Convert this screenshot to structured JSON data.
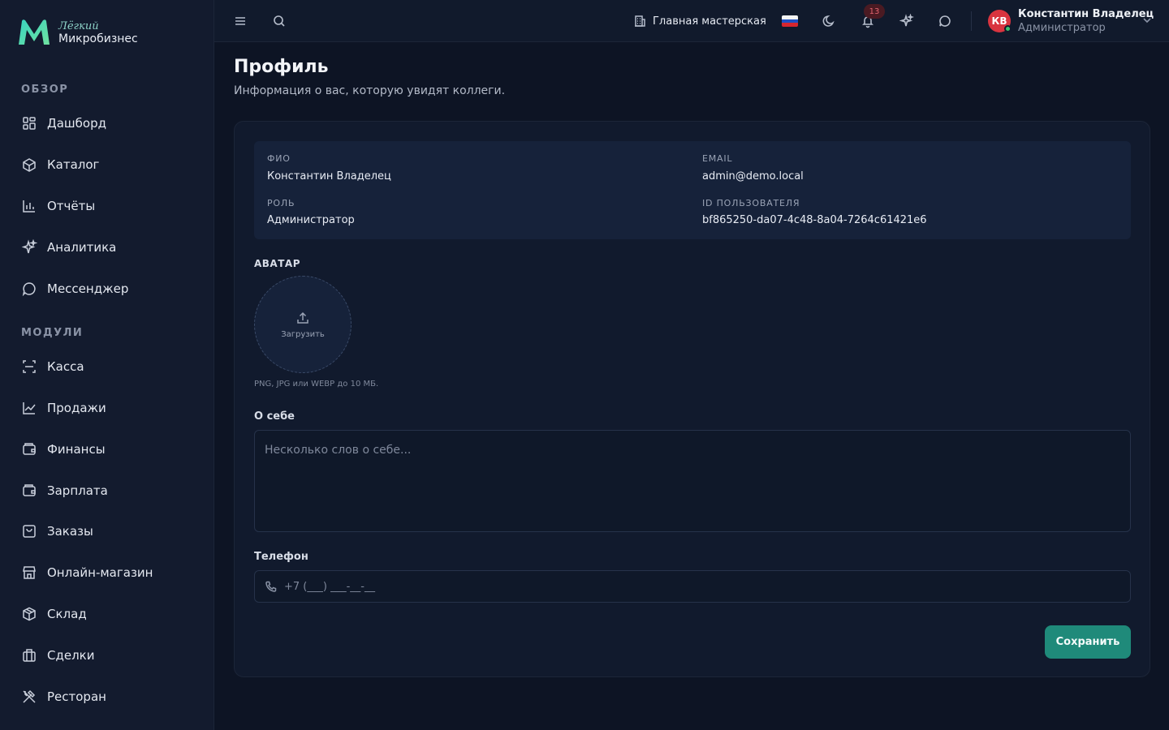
{
  "brand": {
    "top": "Лёгкий",
    "bottom": "Микробизнес"
  },
  "sidebar": {
    "sections": [
      {
        "title": "ОБЗОР",
        "items": [
          {
            "label": "Дашборд",
            "icon": "dashboard-icon"
          },
          {
            "label": "Каталог",
            "icon": "catalog-icon"
          },
          {
            "label": "Отчёты",
            "icon": "reports-icon"
          },
          {
            "label": "Аналитика",
            "icon": "analytics-icon"
          },
          {
            "label": "Мессенджер",
            "icon": "messenger-icon"
          }
        ]
      },
      {
        "title": "МОДУЛИ",
        "items": [
          {
            "label": "Касса",
            "icon": "cashier-icon"
          },
          {
            "label": "Продажи",
            "icon": "sales-icon"
          },
          {
            "label": "Финансы",
            "icon": "finance-icon"
          },
          {
            "label": "Зарплата",
            "icon": "salary-icon"
          },
          {
            "label": "Заказы",
            "icon": "orders-icon"
          },
          {
            "label": "Онлайн-магазин",
            "icon": "store-icon"
          },
          {
            "label": "Склад",
            "icon": "warehouse-icon"
          },
          {
            "label": "Сделки",
            "icon": "deals-icon"
          },
          {
            "label": "Ресторан",
            "icon": "restaurant-icon"
          }
        ]
      }
    ]
  },
  "topbar": {
    "workspace": "Главная мастерская",
    "notifications_count": "13",
    "user": {
      "initials": "КВ",
      "name": "Константин Владелец",
      "role": "Администратор"
    }
  },
  "page": {
    "title": "Профиль",
    "subtitle": "Информация о вас, которую увидят коллеги."
  },
  "info": {
    "full_name_label": "ФИО",
    "full_name": "Константин Владелец",
    "email_label": "EMAIL",
    "email": "admin@demo.local",
    "role_label": "РОЛЬ",
    "role": "Администратор",
    "user_id_label": "ID ПОЛЬЗОВАТЕЛЯ",
    "user_id": "bf865250-da07-4c48-8a04-7264c61421e6"
  },
  "avatar": {
    "label": "АВАТАР",
    "upload": "Загрузить",
    "hint": "PNG, JPG или WEBP до 10 МБ."
  },
  "about": {
    "label": "О себе",
    "placeholder": "Несколько слов о себе..."
  },
  "phone": {
    "label": "Телефон",
    "placeholder": "+7 (___) ___-__-__"
  },
  "save_label": "Сохранить",
  "colors": {
    "accent": "#1f8a7a",
    "background": "#0d1424",
    "sidebar": "#131b2e"
  }
}
